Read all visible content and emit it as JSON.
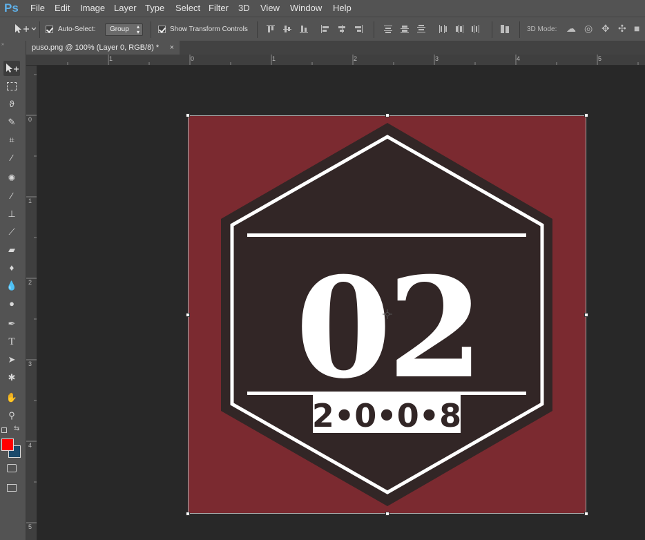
{
  "app": {
    "logo": "Ps"
  },
  "menu": [
    "File",
    "Edit",
    "Image",
    "Layer",
    "Type",
    "Select",
    "Filter",
    "3D",
    "View",
    "Window",
    "Help"
  ],
  "options": {
    "auto_select_label": "Auto-Select:",
    "auto_select_checked": true,
    "group_value": "Group",
    "show_transform_label": "Show Transform Controls",
    "show_transform_checked": true,
    "mode_label": "3D Mode:"
  },
  "document_tab": {
    "title": "puso.png @ 100% (Layer 0, RGB/8) *",
    "close": "×"
  },
  "ruler": {
    "horizontal": [
      "1",
      "0",
      "1",
      "2",
      "3",
      "4",
      "5"
    ],
    "vertical": [
      "0",
      "1",
      "2",
      "3",
      "4",
      "5"
    ]
  },
  "tools": [
    "move-tool",
    "marquee-tool",
    "lasso-tool",
    "quick-select-tool",
    "crop-tool",
    "eyedropper-tool",
    "healing-brush-tool",
    "brush-tool",
    "clone-stamp-tool",
    "history-brush-tool",
    "eraser-tool",
    "paint-bucket-tool",
    "blur-tool",
    "dodge-tool",
    "pen-tool",
    "type-tool",
    "path-select-tool",
    "shape-tool",
    "hand-tool",
    "zoom-tool"
  ],
  "colors": {
    "foreground": "#ff0000",
    "background": "#1b4a6b",
    "art_background": "#7b2a30",
    "hexagon_fill": "#322626"
  },
  "artwork": {
    "big_number": "02",
    "year": "2•0•0•8"
  }
}
